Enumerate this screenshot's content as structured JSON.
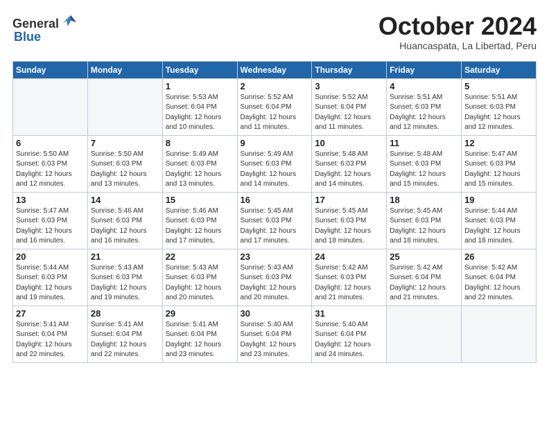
{
  "header": {
    "logo_general": "General",
    "logo_blue": "Blue",
    "month_title": "October 2024",
    "subtitle": "Huancaspata, La Libertad, Peru"
  },
  "weekdays": [
    "Sunday",
    "Monday",
    "Tuesday",
    "Wednesday",
    "Thursday",
    "Friday",
    "Saturday"
  ],
  "weeks": [
    [
      {
        "day": "",
        "info": ""
      },
      {
        "day": "",
        "info": ""
      },
      {
        "day": "1",
        "info": "Sunrise: 5:53 AM\nSunset: 6:04 PM\nDaylight: 12 hours\nand 10 minutes."
      },
      {
        "day": "2",
        "info": "Sunrise: 5:52 AM\nSunset: 6:04 PM\nDaylight: 12 hours\nand 11 minutes."
      },
      {
        "day": "3",
        "info": "Sunrise: 5:52 AM\nSunset: 6:04 PM\nDaylight: 12 hours\nand 11 minutes."
      },
      {
        "day": "4",
        "info": "Sunrise: 5:51 AM\nSunset: 6:03 PM\nDaylight: 12 hours\nand 12 minutes."
      },
      {
        "day": "5",
        "info": "Sunrise: 5:51 AM\nSunset: 6:03 PM\nDaylight: 12 hours\nand 12 minutes."
      }
    ],
    [
      {
        "day": "6",
        "info": "Sunrise: 5:50 AM\nSunset: 6:03 PM\nDaylight: 12 hours\nand 12 minutes."
      },
      {
        "day": "7",
        "info": "Sunrise: 5:50 AM\nSunset: 6:03 PM\nDaylight: 12 hours\nand 13 minutes."
      },
      {
        "day": "8",
        "info": "Sunrise: 5:49 AM\nSunset: 6:03 PM\nDaylight: 12 hours\nand 13 minutes."
      },
      {
        "day": "9",
        "info": "Sunrise: 5:49 AM\nSunset: 6:03 PM\nDaylight: 12 hours\nand 14 minutes."
      },
      {
        "day": "10",
        "info": "Sunrise: 5:48 AM\nSunset: 6:03 PM\nDaylight: 12 hours\nand 14 minutes."
      },
      {
        "day": "11",
        "info": "Sunrise: 5:48 AM\nSunset: 6:03 PM\nDaylight: 12 hours\nand 15 minutes."
      },
      {
        "day": "12",
        "info": "Sunrise: 5:47 AM\nSunset: 6:03 PM\nDaylight: 12 hours\nand 15 minutes."
      }
    ],
    [
      {
        "day": "13",
        "info": "Sunrise: 5:47 AM\nSunset: 6:03 PM\nDaylight: 12 hours\nand 16 minutes."
      },
      {
        "day": "14",
        "info": "Sunrise: 5:46 AM\nSunset: 6:03 PM\nDaylight: 12 hours\nand 16 minutes."
      },
      {
        "day": "15",
        "info": "Sunrise: 5:46 AM\nSunset: 6:03 PM\nDaylight: 12 hours\nand 17 minutes."
      },
      {
        "day": "16",
        "info": "Sunrise: 5:45 AM\nSunset: 6:03 PM\nDaylight: 12 hours\nand 17 minutes."
      },
      {
        "day": "17",
        "info": "Sunrise: 5:45 AM\nSunset: 6:03 PM\nDaylight: 12 hours\nand 18 minutes."
      },
      {
        "day": "18",
        "info": "Sunrise: 5:45 AM\nSunset: 6:03 PM\nDaylight: 12 hours\nand 18 minutes."
      },
      {
        "day": "19",
        "info": "Sunrise: 5:44 AM\nSunset: 6:03 PM\nDaylight: 12 hours\nand 18 minutes."
      }
    ],
    [
      {
        "day": "20",
        "info": "Sunrise: 5:44 AM\nSunset: 6:03 PM\nDaylight: 12 hours\nand 19 minutes."
      },
      {
        "day": "21",
        "info": "Sunrise: 5:43 AM\nSunset: 6:03 PM\nDaylight: 12 hours\nand 19 minutes."
      },
      {
        "day": "22",
        "info": "Sunrise: 5:43 AM\nSunset: 6:03 PM\nDaylight: 12 hours\nand 20 minutes."
      },
      {
        "day": "23",
        "info": "Sunrise: 5:43 AM\nSunset: 6:03 PM\nDaylight: 12 hours\nand 20 minutes."
      },
      {
        "day": "24",
        "info": "Sunrise: 5:42 AM\nSunset: 6:03 PM\nDaylight: 12 hours\nand 21 minutes."
      },
      {
        "day": "25",
        "info": "Sunrise: 5:42 AM\nSunset: 6:04 PM\nDaylight: 12 hours\nand 21 minutes."
      },
      {
        "day": "26",
        "info": "Sunrise: 5:42 AM\nSunset: 6:04 PM\nDaylight: 12 hours\nand 22 minutes."
      }
    ],
    [
      {
        "day": "27",
        "info": "Sunrise: 5:41 AM\nSunset: 6:04 PM\nDaylight: 12 hours\nand 22 minutes."
      },
      {
        "day": "28",
        "info": "Sunrise: 5:41 AM\nSunset: 6:04 PM\nDaylight: 12 hours\nand 22 minutes."
      },
      {
        "day": "29",
        "info": "Sunrise: 5:41 AM\nSunset: 6:04 PM\nDaylight: 12 hours\nand 23 minutes."
      },
      {
        "day": "30",
        "info": "Sunrise: 5:40 AM\nSunset: 6:04 PM\nDaylight: 12 hours\nand 23 minutes."
      },
      {
        "day": "31",
        "info": "Sunrise: 5:40 AM\nSunset: 6:04 PM\nDaylight: 12 hours\nand 24 minutes."
      },
      {
        "day": "",
        "info": ""
      },
      {
        "day": "",
        "info": ""
      }
    ]
  ]
}
